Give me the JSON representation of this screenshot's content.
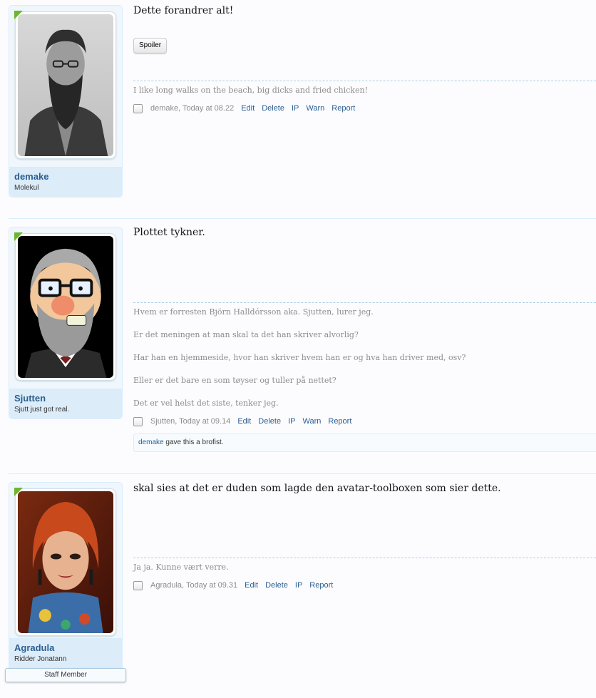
{
  "posts": [
    {
      "username": "demake",
      "user_title": "Molekul",
      "message": "Dette forandrer alt!",
      "spoiler_label": "Spoiler",
      "signature": [
        "I like long walks on the beach, big dicks and fried chicken!"
      ],
      "author": "demake, Today at 08.22",
      "actions": [
        "Edit",
        "Delete",
        "IP",
        "Warn",
        "Report"
      ]
    },
    {
      "username": "Sjutten",
      "user_title": "Sjutt just got real.",
      "message": "Plottet tykner.",
      "signature": [
        "Hvem er forresten Björn Halldórsson aka. Sjutten, lurer jeg.",
        "Er det meningen at man skal ta det han skriver alvorlig?",
        "Har han en hjemmeside, hvor han skriver hvem han er og hva han driver med, osv?",
        "Eller er det bare en som tøyser og tuller på nettet?",
        "Det er vel helst det siste, tenker jeg."
      ],
      "author": "Sjutten, Today at 09.14",
      "actions": [
        "Edit",
        "Delete",
        "IP",
        "Warn",
        "Report"
      ],
      "likes": {
        "user": "demake",
        "text": "gave this a brofist."
      }
    },
    {
      "username": "Agradula",
      "user_title": "Ridder Jonatann",
      "staff_label": "Staff Member",
      "message": "skal sies at det er duden som lagde den avatar-toolboxen som sier dette.",
      "signature": [
        "Ja ja. Kunne vært verre."
      ],
      "author": "Agradula, Today at 09.31",
      "actions": [
        "Edit",
        "Delete",
        "IP",
        "Report"
      ]
    }
  ]
}
